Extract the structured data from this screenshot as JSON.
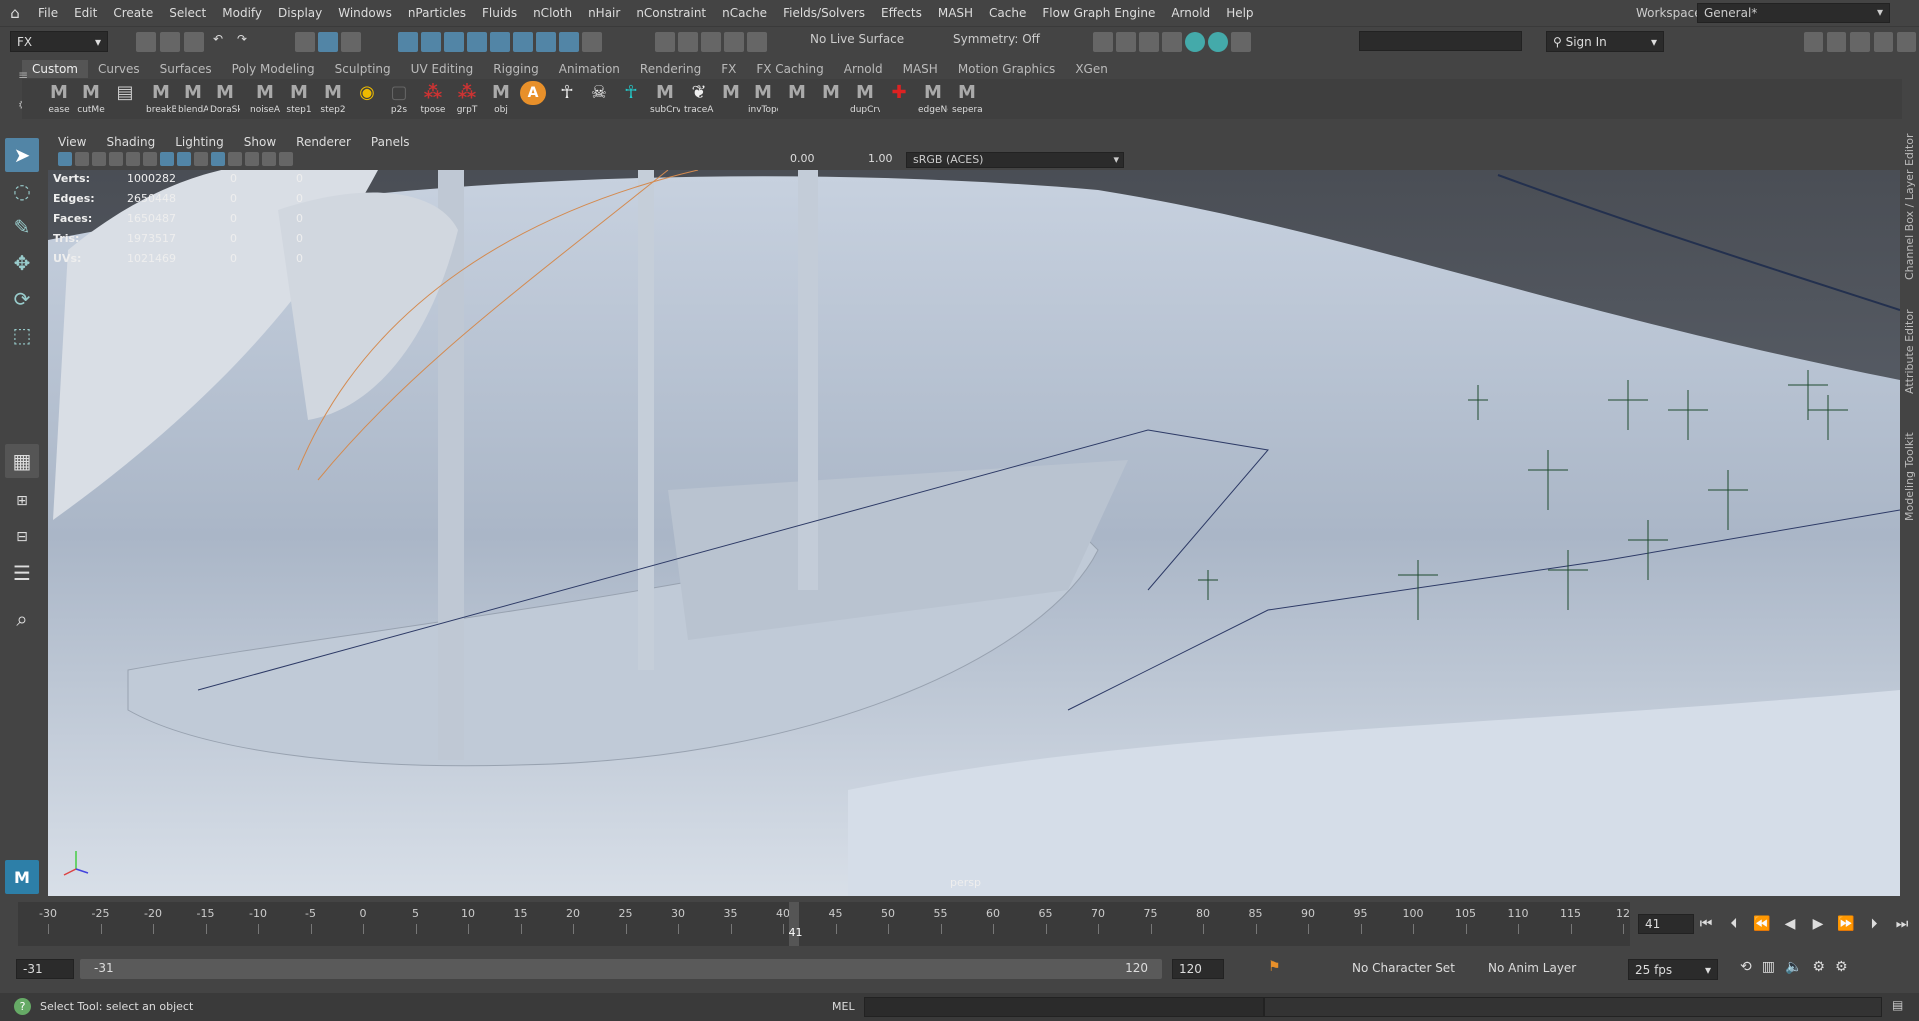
{
  "menubar": {
    "items": [
      "File",
      "Edit",
      "Create",
      "Select",
      "Modify",
      "Display",
      "Windows",
      "nParticles",
      "Fluids",
      "nCloth",
      "nHair",
      "nConstraint",
      "nCache",
      "Fields/Solvers",
      "Effects",
      "MASH",
      "Cache",
      "Flow Graph Engine",
      "Arnold",
      "Help"
    ],
    "workspace_label": "Workspace:",
    "workspace_value": "General*"
  },
  "statusline": {
    "menuset": "FX",
    "live_surface": "No Live Surface",
    "symmetry": "Symmetry: Off",
    "sign_in": "Sign In"
  },
  "shelf": {
    "tabs": [
      "Custom",
      "Curves",
      "Surfaces",
      "Poly Modeling",
      "Sculpting",
      "UV Editing",
      "Rigging",
      "Animation",
      "Rendering",
      "FX",
      "FX Caching",
      "Arnold",
      "MASH",
      "Motion Graphics",
      "XGen"
    ],
    "active_tab": "Custom",
    "items": [
      "ease",
      "cutMe",
      "",
      "breakB",
      "blendA",
      "DoraSk",
      "",
      "noiseAt",
      "step1",
      "step2",
      "",
      "p2s",
      "tpose",
      "grpT",
      "obj",
      "",
      "",
      "",
      "",
      "subCrvl",
      "traceAn",
      "",
      "invTopo",
      "",
      "",
      "dupCrv",
      "",
      "edgeNe",
      "seperat"
    ]
  },
  "viewport": {
    "menus": [
      "View",
      "Shading",
      "Lighting",
      "Show",
      "Renderer",
      "Panels"
    ],
    "exposure": "0.00",
    "gamma": "1.00",
    "color_space": "sRGB (ACES)",
    "camera": "persp",
    "hud": [
      {
        "label": "Verts:",
        "value": "1000282",
        "a": "0",
        "b": "0"
      },
      {
        "label": "Edges:",
        "value": "2650448",
        "a": "0",
        "b": "0"
      },
      {
        "label": "Faces:",
        "value": "1650487",
        "a": "0",
        "b": "0"
      },
      {
        "label": "Tris:",
        "value": "1973517",
        "a": "0",
        "b": "0"
      },
      {
        "label": "UVs:",
        "value": "1021469",
        "a": "0",
        "b": "0"
      }
    ]
  },
  "side_tabs": [
    "Channel Box / Layer Editor",
    "Attribute Editor",
    "Modeling Toolkit"
  ],
  "timeslider": {
    "ticks": [
      "-30",
      "-25",
      "-20",
      "-15",
      "-10",
      "-5",
      "0",
      "5",
      "10",
      "15",
      "20",
      "25",
      "30",
      "35",
      "40",
      "45",
      "50",
      "55",
      "60",
      "65",
      "70",
      "75",
      "80",
      "85",
      "90",
      "95",
      "100",
      "105",
      "110",
      "115",
      "12"
    ],
    "current_frame": "41",
    "current_frame_field": "41"
  },
  "range": {
    "start": "-31",
    "inner_start": "-31",
    "inner_end": "120",
    "end": "120",
    "character_set": "No Character Set",
    "anim_layer": "No Anim Layer",
    "fps": "25 fps"
  },
  "cmdline": {
    "help": "Select Tool: select an object",
    "lang": "MEL"
  }
}
